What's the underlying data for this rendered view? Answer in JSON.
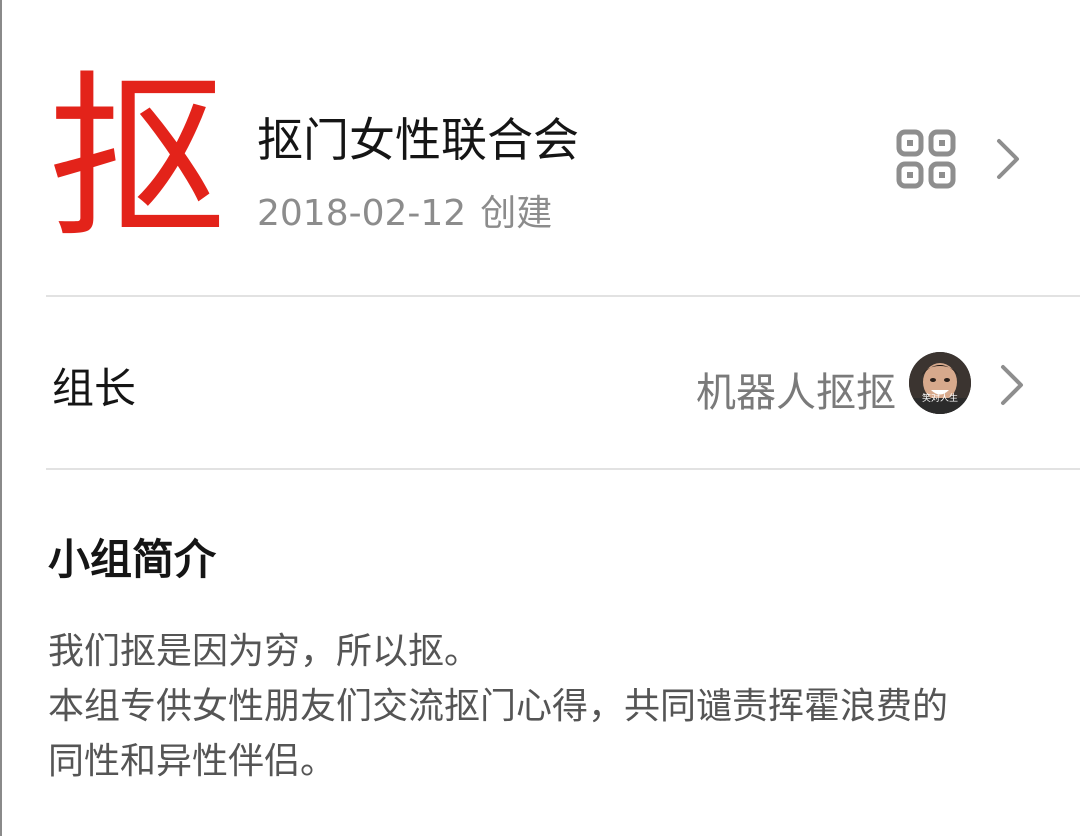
{
  "header": {
    "logo_char": "抠",
    "title": "抠门女性联合会",
    "created_date": "2018-02-12",
    "created_label": "创建",
    "qr_icon": "qr-code-icon",
    "chevron_icon": "chevron-right-icon"
  },
  "owner": {
    "label": "组长",
    "name": "机器人抠抠",
    "avatar_caption": "笑对人生"
  },
  "intro": {
    "title": "小组简介",
    "lines": [
      "我们抠是因为穷，所以抠。",
      "本组专供女性朋友们交流抠门心得，共同谴责挥霍浪费的",
      "同性和异性伴侣。"
    ]
  },
  "colors": {
    "logo_red": "#e3231a",
    "title_text": "#151515",
    "secondary_text": "#8c8c8c",
    "divider": "#e2e2e2",
    "icon_gray": "#8e8e8e"
  }
}
